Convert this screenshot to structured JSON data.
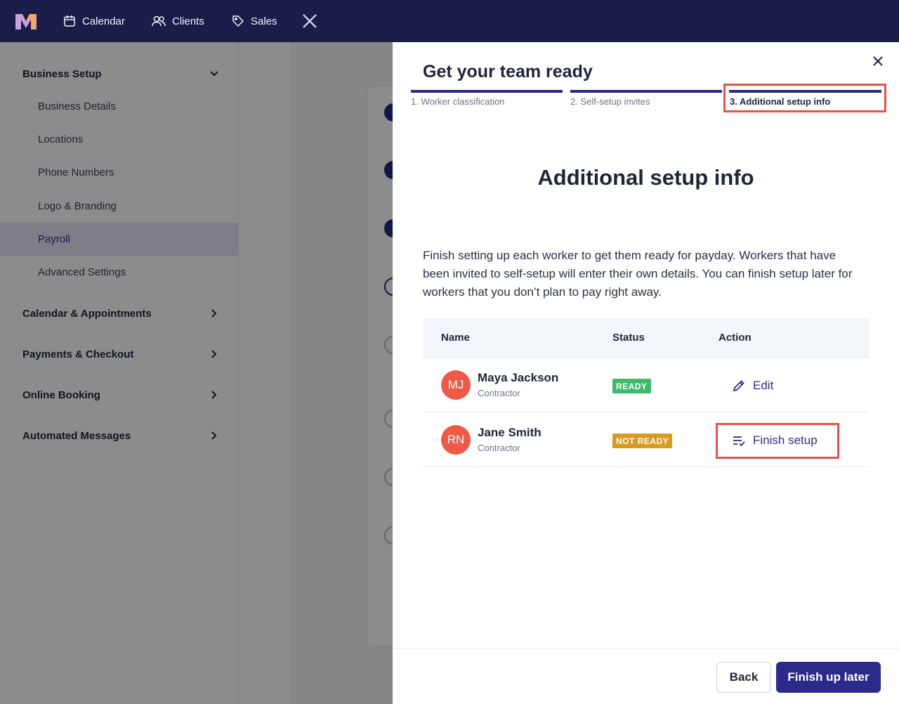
{
  "topnav": {
    "items": [
      {
        "label": "Calendar",
        "icon": "calendar-icon"
      },
      {
        "label": "Clients",
        "icon": "users-icon"
      },
      {
        "label": "Sales",
        "icon": "tag-icon"
      }
    ]
  },
  "sidebar": {
    "sections": [
      {
        "label": "Business Setup",
        "expanded": true
      },
      {
        "label": "Calendar & Appointments",
        "expanded": false
      },
      {
        "label": "Payments & Checkout",
        "expanded": false
      },
      {
        "label": "Online Booking",
        "expanded": false
      },
      {
        "label": "Automated Messages",
        "expanded": false
      }
    ],
    "items": [
      {
        "label": "Business Details"
      },
      {
        "label": "Locations"
      },
      {
        "label": "Phone Numbers"
      },
      {
        "label": "Logo & Branding"
      },
      {
        "label": "Payroll",
        "active": true
      },
      {
        "label": "Advanced Settings"
      }
    ]
  },
  "drawer": {
    "title": "Get your team ready",
    "steps": [
      {
        "label": "1. Worker classification"
      },
      {
        "label": "2. Self-setup invites"
      },
      {
        "label": "3. Additional setup info",
        "current": true
      }
    ],
    "heading": "Additional setup info",
    "description": "Finish setting up each worker to get them ready for payday. Workers that have been invited to self-setup will enter their own details. You can finish setup later for workers that you don’t plan to pay right away.",
    "table": {
      "columns": {
        "name": "Name",
        "status": "Status",
        "action": "Action"
      },
      "rows": [
        {
          "initials": "MJ",
          "name": "Maya Jackson",
          "role": "Contractor",
          "status": "READY",
          "action": "Edit"
        },
        {
          "initials": "RN",
          "name": "Jane Smith",
          "role": "Contractor",
          "status": "NOT READY",
          "action": "Finish setup"
        }
      ]
    },
    "footer": {
      "back": "Back",
      "finish_later": "Finish up later"
    }
  },
  "colors": {
    "topbar": "#1a1d4a",
    "accent": "#2b2a8a",
    "highlight": "#e2544a",
    "ready": "#3dbb6a",
    "not_ready": "#d89a22",
    "avatar": "#ef5a47"
  }
}
